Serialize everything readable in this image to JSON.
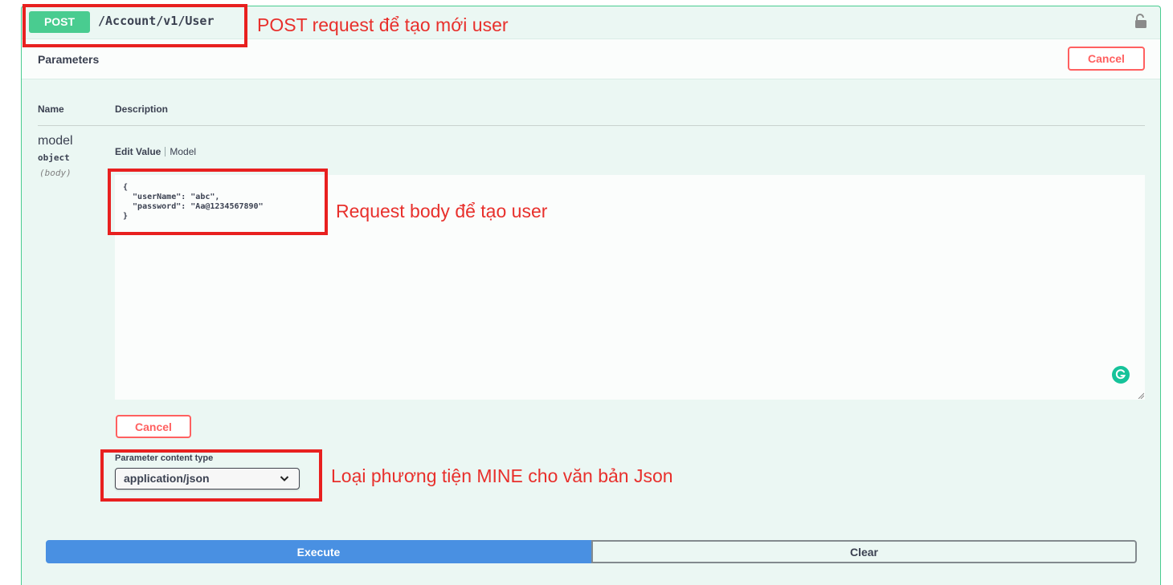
{
  "operation": {
    "method": "POST",
    "path": "/Account/v1/User"
  },
  "parameters_header": {
    "title": "Parameters",
    "cancel_label": "Cancel"
  },
  "table": {
    "col_name": "Name",
    "col_description": "Description"
  },
  "param": {
    "name": "model",
    "type": "object",
    "location": "(body)",
    "tab_edit": "Edit Value",
    "tab_model": "Model",
    "body_value": "{\n  \"userName\": \"abc\",\n  \"password\": \"Aa@1234567890\"\n}",
    "cancel_label": "Cancel"
  },
  "content_type": {
    "label": "Parameter content type",
    "selected": "application/json"
  },
  "actions": {
    "execute_label": "Execute",
    "clear_label": "Clear"
  },
  "annotations": {
    "post": "POST request để tạo mới user",
    "body": "Request body để tạo user",
    "mime": "Loại phương tiện MINE cho văn bản Json"
  },
  "colors": {
    "post_green": "#49cc90",
    "execute_blue": "#4990e2",
    "cancel_red": "#ff6060",
    "annotation_red": "#e8201f"
  },
  "icons": {
    "lock": "unlock-icon",
    "grammarly": "grammarly-icon",
    "select": "chevron-down-icon"
  }
}
